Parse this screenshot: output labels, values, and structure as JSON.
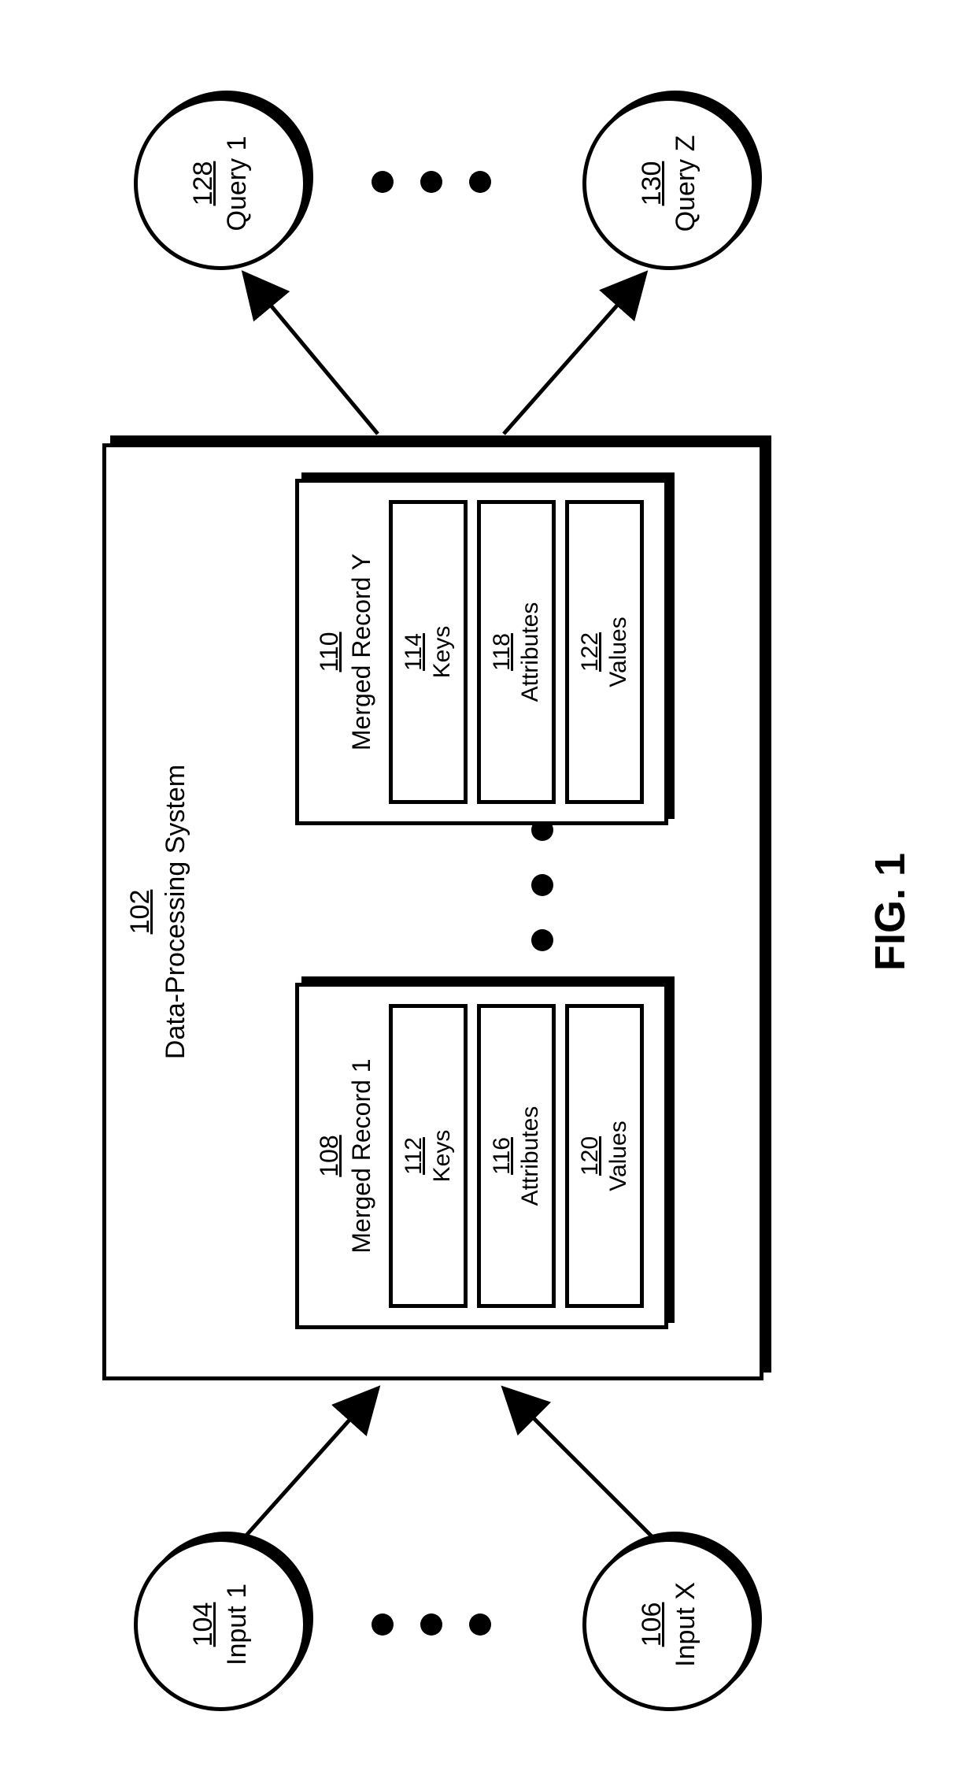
{
  "figure_caption": "FIG. 1",
  "inputs": [
    {
      "ref": "104",
      "label": "Input 1"
    },
    {
      "ref": "106",
      "label": "Input X"
    }
  ],
  "queries": [
    {
      "ref": "128",
      "label": "Query 1"
    },
    {
      "ref": "130",
      "label": "Query Z"
    }
  ],
  "system": {
    "ref": "102",
    "label": "Data-Processing System",
    "records": [
      {
        "ref": "108",
        "label": "Merged Record 1",
        "cells": [
          {
            "ref": "112",
            "label": "Keys"
          },
          {
            "ref": "116",
            "label": "Attributes"
          },
          {
            "ref": "120",
            "label": "Values"
          }
        ]
      },
      {
        "ref": "110",
        "label": "Merged Record Y",
        "cells": [
          {
            "ref": "114",
            "label": "Keys"
          },
          {
            "ref": "118",
            "label": "Attributes"
          },
          {
            "ref": "122",
            "label": "Values"
          }
        ]
      }
    ]
  }
}
